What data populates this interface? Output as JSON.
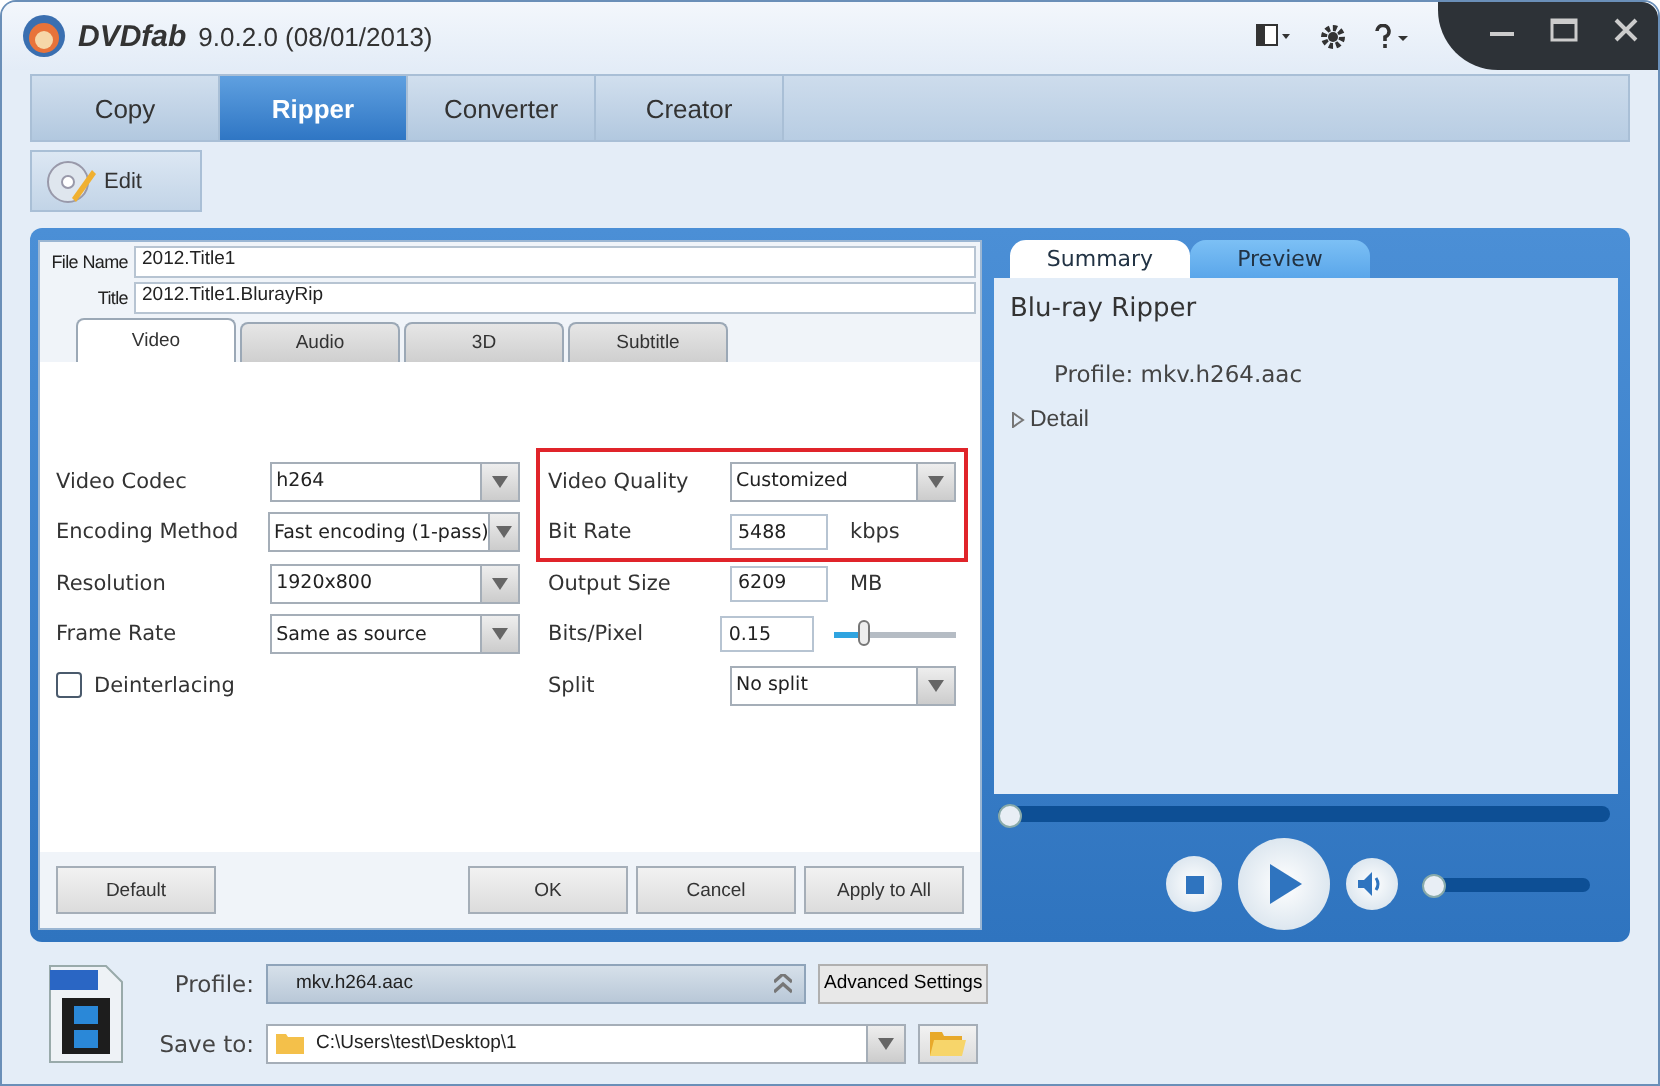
{
  "window": {
    "app_name": "DVDfab",
    "version": "9.0.2.0 (08/01/2013)"
  },
  "main_tabs": [
    {
      "label": "Copy",
      "selected": false
    },
    {
      "label": "Ripper",
      "selected": true
    },
    {
      "label": "Converter",
      "selected": false
    },
    {
      "label": "Creator",
      "selected": false
    }
  ],
  "toolbar": {
    "edit_button": "Edit"
  },
  "title_fields": [
    {
      "label": "File Name",
      "value": "2012.Title1"
    },
    {
      "label": "Title",
      "value": "2012.Title1.BlurayRip"
    }
  ],
  "sub_tabs": [
    {
      "label": "Video",
      "selected": true
    },
    {
      "label": "Audio",
      "selected": false
    },
    {
      "label": "3D",
      "selected": false
    },
    {
      "label": "Subtitle",
      "selected": false
    }
  ],
  "left_fields": [
    {
      "kind": "dropdown",
      "label": "Video Codec",
      "value": "h264"
    },
    {
      "kind": "dropdown",
      "label": "Encoding Method",
      "value": "Fast encoding (1-pass)"
    },
    {
      "kind": "dropdown",
      "label": "Resolution",
      "value": "1920x800"
    },
    {
      "kind": "dropdown",
      "label": "Frame Rate",
      "value": "Same as source"
    },
    {
      "kind": "checkbox",
      "label": "Deinterlacing",
      "checked": false
    }
  ],
  "right_fields": [
    {
      "kind": "dropdown",
      "label": "Video Quality",
      "value": "Customized",
      "highlighted": true
    },
    {
      "kind": "input",
      "label": "Bit Rate",
      "value": "5488",
      "unit": "kbps",
      "highlighted": true
    },
    {
      "kind": "input",
      "label": "Output Size",
      "value": "6209",
      "unit": "MB",
      "highlighted": false
    },
    {
      "kind": "slider",
      "label": "Bits/Pixel",
      "value": "0.15",
      "level": 0.25,
      "highlighted": false
    },
    {
      "kind": "dropdown",
      "label": "Split",
      "value": "No split",
      "highlighted": false
    }
  ],
  "dialog_buttons": {
    "left": [
      "Default"
    ],
    "right": [
      "OK",
      "Cancel",
      "Apply to All"
    ]
  },
  "side_tabs": [
    {
      "label": "Summary",
      "selected": true
    },
    {
      "label": "Preview",
      "selected": false
    }
  ],
  "summary": {
    "heading": "Blu-ray Ripper",
    "profile": "Profile: mkv.h264.aac",
    "detail": "Detail",
    "detail_expanded": false
  },
  "player": {
    "position": {
      "level": 0
    },
    "volume": {
      "level": 0
    }
  },
  "output": {
    "profile_label": "Profile:",
    "profile": "mkv.h264.aac",
    "advanced_button": "Advanced Settings",
    "save_label": "Save to:",
    "save_path": "C:\\Users\\test\\Desktop\\1"
  }
}
